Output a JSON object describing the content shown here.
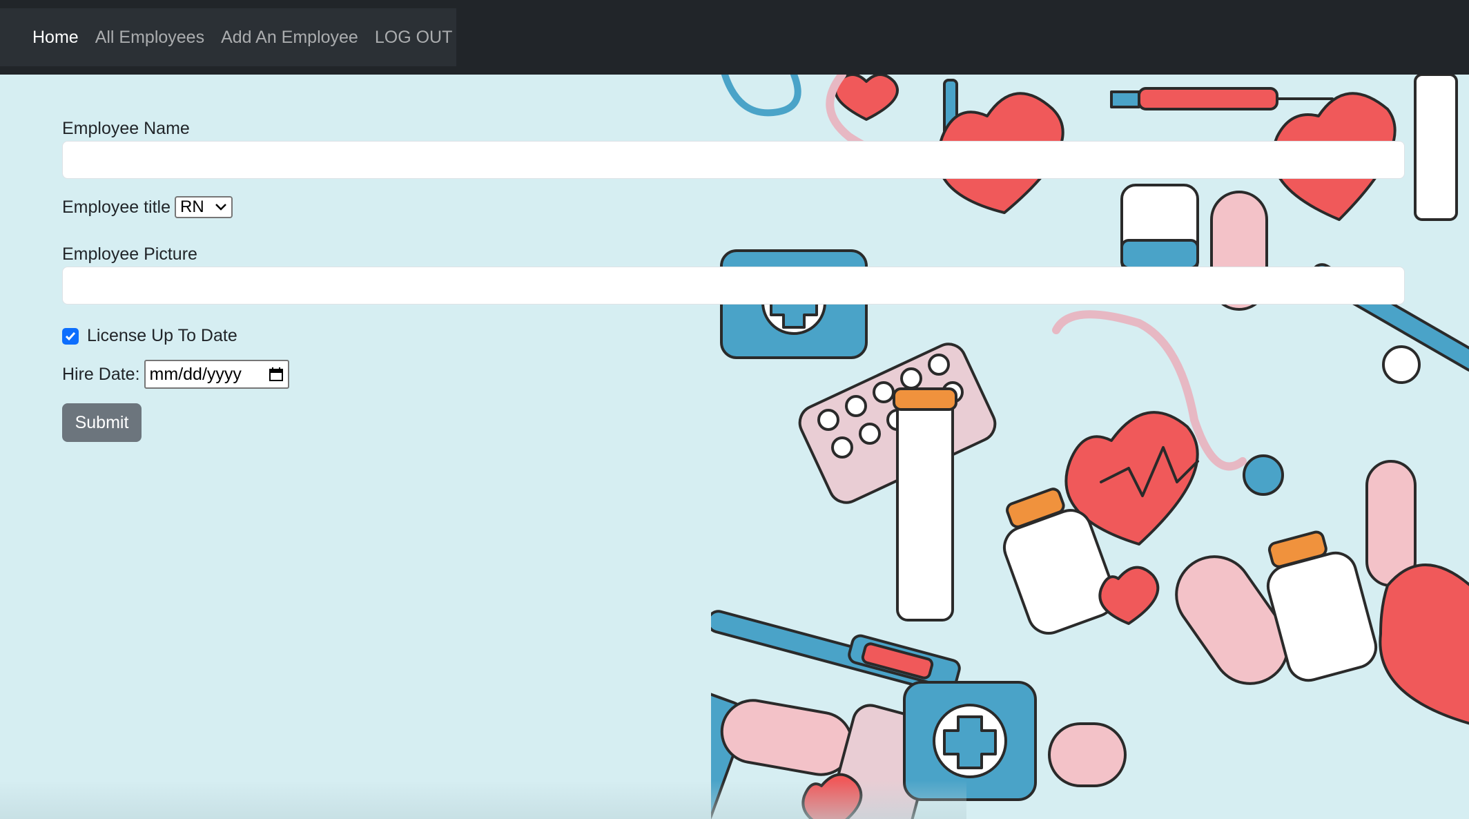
{
  "nav": {
    "items": [
      {
        "label": "Home",
        "active": true
      },
      {
        "label": "All Employees",
        "active": false
      },
      {
        "label": "Add An Employee",
        "active": false
      },
      {
        "label": "LOG OUT",
        "active": false
      }
    ]
  },
  "form": {
    "name_label": "Employee Name",
    "name_value": "",
    "title_label": "Employee title",
    "title_selected": "RN",
    "picture_label": "Employee Picture",
    "picture_value": "",
    "license_label": "License Up To Date",
    "license_checked": true,
    "hire_date_label": "Hire Date:",
    "hire_date_placeholder": "mm/dd/yyyy",
    "submit_label": "Submit"
  },
  "colors": {
    "navbar": "#212529",
    "background": "#d6eef2",
    "checkbox": "#0d6efd",
    "submit": "#6c757d"
  }
}
